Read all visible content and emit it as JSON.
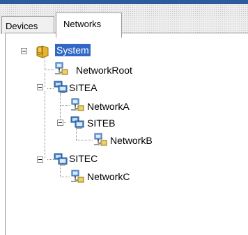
{
  "tabs": [
    {
      "label": "Devices",
      "active": false
    },
    {
      "label": "Networks",
      "active": true
    }
  ],
  "tree": {
    "root": {
      "label": "System",
      "icon": "database-folder-icon",
      "selected": true,
      "expanded": true
    },
    "nodes": [
      {
        "label": "NetworkRoot",
        "icon": "network-icon"
      },
      {
        "label": "SITEA",
        "icon": "site-computers-icon",
        "expanded": true
      },
      {
        "label": "NetworkA",
        "icon": "network-icon"
      },
      {
        "label": "SITEB",
        "icon": "site-computers-icon",
        "expanded": true
      },
      {
        "label": "NetworkB",
        "icon": "network-icon"
      },
      {
        "label": "SITEC",
        "icon": "site-computers-icon",
        "expanded": true
      },
      {
        "label": "NetworkC",
        "icon": "network-icon"
      }
    ]
  },
  "colors": {
    "selection": "#3168c6",
    "title_strip": "#2f5a9e"
  }
}
